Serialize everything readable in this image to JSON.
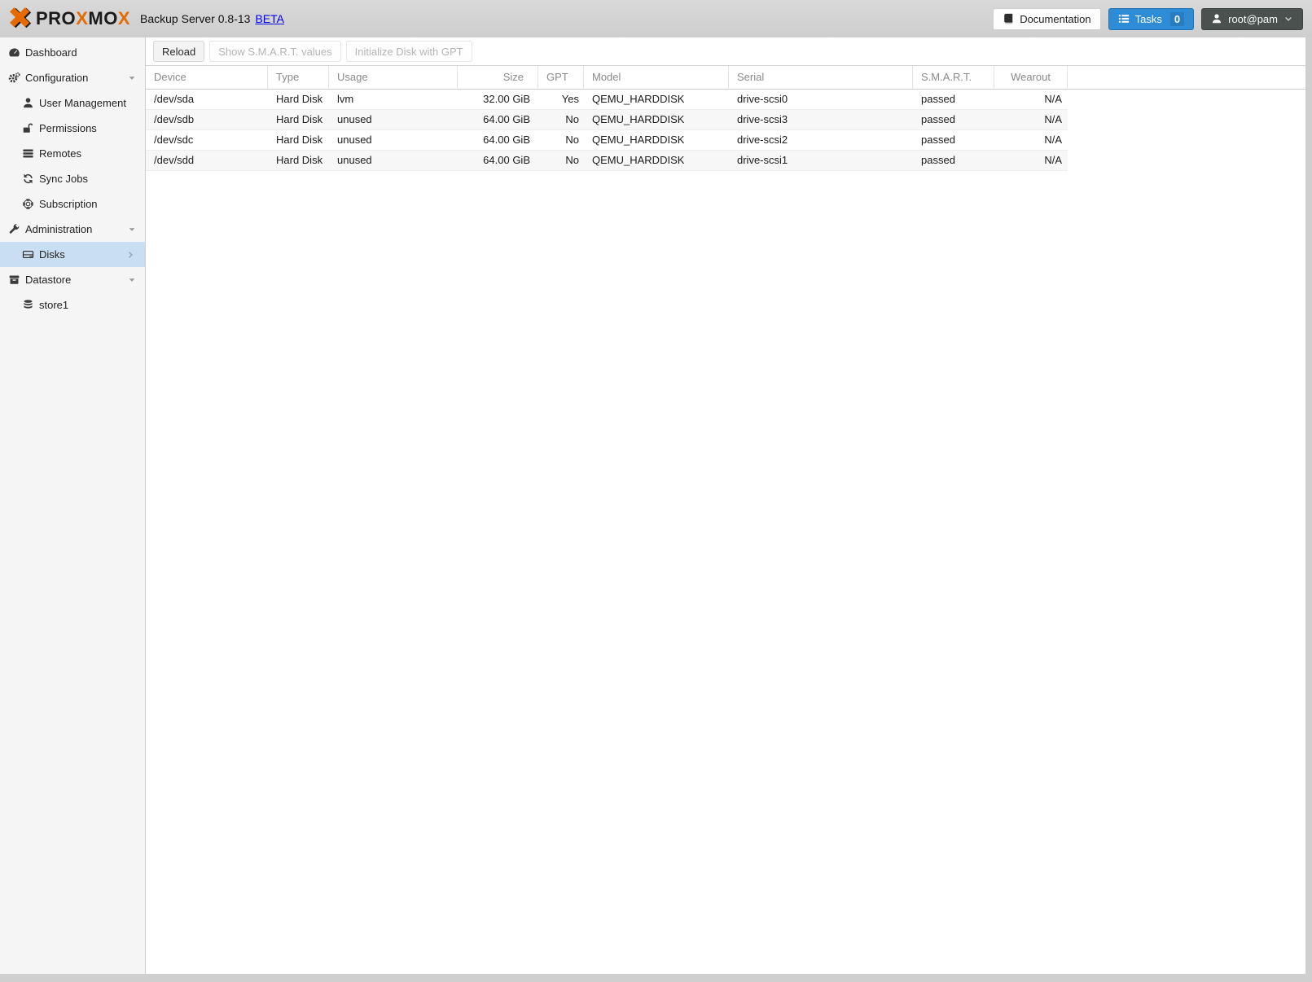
{
  "colors": {
    "accent_blue": "#2e8bd5",
    "selected_item_bg": "#c9def2",
    "logo_orange": "#e66a00",
    "header_bar": "#d0d0d0",
    "user_button": "#4a514f",
    "link_blue": "#0000ee"
  },
  "header": {
    "logo_parts": [
      "PRO",
      "X",
      "MO",
      "X"
    ],
    "title": "Backup Server 0.8-13",
    "beta": "BETA",
    "documentation": "Documentation",
    "tasks": "Tasks",
    "tasks_count": "0",
    "user": "root@pam"
  },
  "sidebar": {
    "items": [
      {
        "label": "Dashboard",
        "icon": "dashboard-icon"
      },
      {
        "label": "Configuration",
        "icon": "gears-icon"
      },
      {
        "label": "User Management",
        "icon": "user-icon"
      },
      {
        "label": "Permissions",
        "icon": "unlock-icon"
      },
      {
        "label": "Remotes",
        "icon": "server-icon"
      },
      {
        "label": "Sync Jobs",
        "icon": "refresh-icon"
      },
      {
        "label": "Subscription",
        "icon": "life-ring-icon"
      },
      {
        "label": "Administration",
        "icon": "wrench-icon"
      },
      {
        "label": "Disks",
        "icon": "hdd-icon",
        "selected": true
      },
      {
        "label": "Datastore",
        "icon": "archive-icon"
      },
      {
        "label": "store1",
        "icon": "database-icon"
      }
    ]
  },
  "toolbar": {
    "reload": "Reload",
    "show_smart": "Show S.M.A.R.T. values",
    "init_gpt": "Initialize Disk with GPT"
  },
  "table": {
    "columns": {
      "device": "Device",
      "type": "Type",
      "usage": "Usage",
      "size": "Size",
      "gpt": "GPT",
      "model": "Model",
      "serial": "Serial",
      "smart": "S.M.A.R.T.",
      "wearout": "Wearout"
    },
    "rows": [
      {
        "device": "/dev/sda",
        "type": "Hard Disk",
        "usage": "lvm",
        "size": "32.00 GiB",
        "gpt": "Yes",
        "model": "QEMU_HARDDISK",
        "serial": "drive-scsi0",
        "smart": "passed",
        "wearout": "N/A"
      },
      {
        "device": "/dev/sdb",
        "type": "Hard Disk",
        "usage": "unused",
        "size": "64.00 GiB",
        "gpt": "No",
        "model": "QEMU_HARDDISK",
        "serial": "drive-scsi3",
        "smart": "passed",
        "wearout": "N/A"
      },
      {
        "device": "/dev/sdc",
        "type": "Hard Disk",
        "usage": "unused",
        "size": "64.00 GiB",
        "gpt": "No",
        "model": "QEMU_HARDDISK",
        "serial": "drive-scsi2",
        "smart": "passed",
        "wearout": "N/A"
      },
      {
        "device": "/dev/sdd",
        "type": "Hard Disk",
        "usage": "unused",
        "size": "64.00 GiB",
        "gpt": "No",
        "model": "QEMU_HARDDISK",
        "serial": "drive-scsi1",
        "smart": "passed",
        "wearout": "N/A"
      }
    ]
  }
}
